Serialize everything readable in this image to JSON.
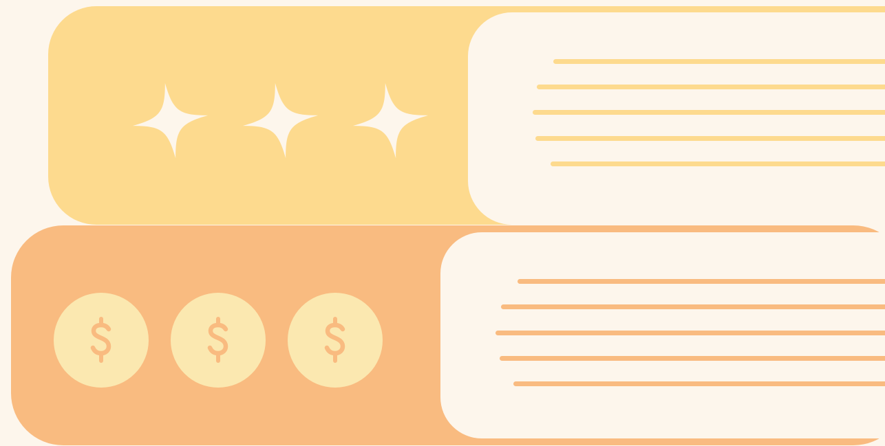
{
  "palette": {
    "background": "#FDF6EC",
    "yellow": "#FDDA8E",
    "orange": "#F9BB80",
    "coin": "#FBE8B0"
  },
  "top_row": {
    "icon": "sparkle-star-icon",
    "icon_count": 3,
    "line_count": 5
  },
  "bottom_row": {
    "icon": "dollar-coin-icon",
    "icon_count": 3,
    "line_count": 5,
    "coin_labels": [
      "$",
      "$",
      "$"
    ]
  }
}
